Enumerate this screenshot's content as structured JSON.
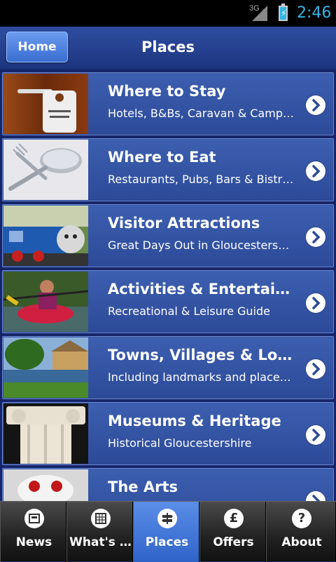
{
  "status_bar": {
    "network": "3G",
    "time": "2:46"
  },
  "header": {
    "home_label": "Home",
    "title": "Places"
  },
  "list": {
    "items": [
      {
        "title": "Where to Stay",
        "subtitle": "Hotels, B&Bs, Caravan & Campi…",
        "image": "do-not-disturb-door-sign"
      },
      {
        "title": "Where to Eat",
        "subtitle": "Restaurants, Pubs, Bars & Bistr…",
        "image": "fork-and-spoon"
      },
      {
        "title": "Visitor Attractions",
        "subtitle": "Great Days Out in Gloucestersh…",
        "image": "blue-train-engine"
      },
      {
        "title": "Activities & Entertainm…",
        "subtitle": "Recreational & Leisure Guide",
        "image": "kayaker"
      },
      {
        "title": "Towns, Villages & Loc…",
        "subtitle": "Including landmarks and place…",
        "image": "village-by-river"
      },
      {
        "title": "Museums & Heritage",
        "subtitle": "Historical Gloucestershire",
        "image": "stone-column"
      },
      {
        "title": "The Arts",
        "subtitle": "",
        "image": "theatre-mask"
      }
    ]
  },
  "tab_bar": {
    "tabs": [
      {
        "label": "News",
        "icon": "news-icon",
        "active": false
      },
      {
        "label": "What's …",
        "icon": "calendar-icon",
        "active": false
      },
      {
        "label": "Places",
        "icon": "signpost-icon",
        "active": true
      },
      {
        "label": "Offers",
        "icon": "pound-icon",
        "active": false
      },
      {
        "label": "About",
        "icon": "question-icon",
        "active": false
      }
    ]
  },
  "colors": {
    "accent": "#33b5e5",
    "row_bg": "#3d5fb0",
    "active_tab": "#3f74d8"
  }
}
